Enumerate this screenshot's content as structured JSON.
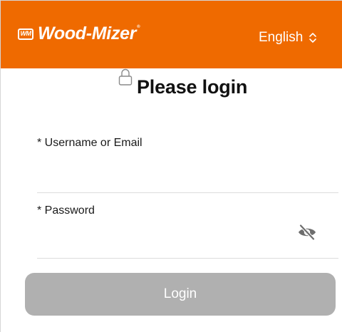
{
  "header": {
    "brand": "Wood-Mizer",
    "brand_mark": "WM",
    "logo_icon": "wood-mizer-logo",
    "language_selected": "English",
    "language_icon": "chevron-up-down-icon",
    "background_color": "#ef6a00"
  },
  "form": {
    "title": "Please login",
    "title_icon": "lock-icon",
    "username_label": "* Username or Email",
    "username_value": "",
    "password_label": "* Password",
    "password_value": "",
    "password_toggle_icon": "eye-slash-icon",
    "login_button_label": "Login",
    "login_button_state": "disabled",
    "login_button_color": "#b0b0b0"
  }
}
